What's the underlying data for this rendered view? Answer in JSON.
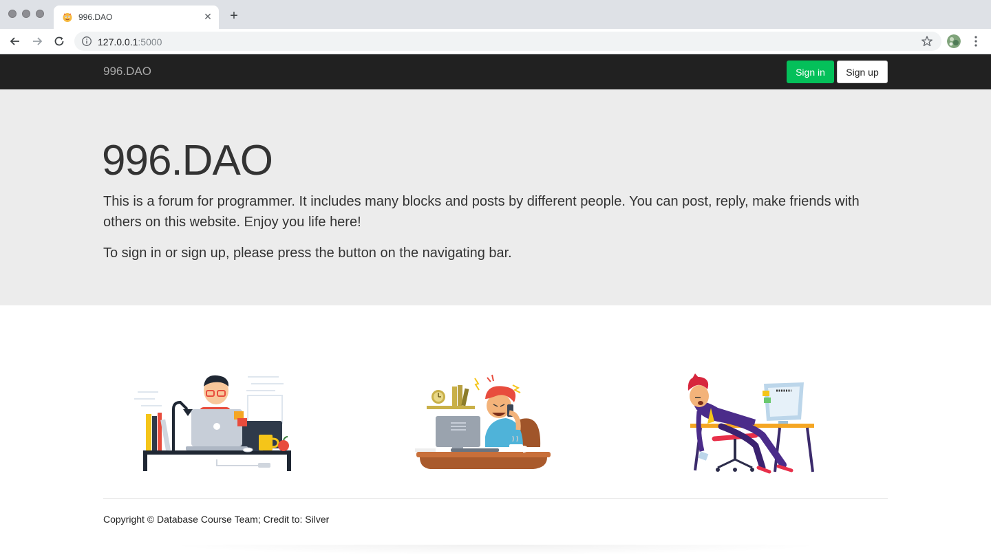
{
  "browser": {
    "tab_title": "996.DAO",
    "tab_favicon": "emoji-face-icon",
    "url_host": "127.0.0.1",
    "url_port": ":5000"
  },
  "navbar": {
    "brand": "996.DAO",
    "signin_label": "Sign in",
    "signup_label": "Sign up",
    "colors": {
      "background": "#212121",
      "signin": "#04c05a"
    }
  },
  "jumbotron": {
    "title": "996.DAO",
    "lead": "This is a forum for programmer. It includes many blocks and posts by different people. You can post, reply, make friends with others on this website. Enjoy you life here!",
    "sub": "To sign in or sign up, please press the button on the navigating bar."
  },
  "illustrations": [
    {
      "icon": "programmer-at-laptop-illustration"
    },
    {
      "icon": "stressed-programmer-on-phone-illustration"
    },
    {
      "icon": "tired-programmer-sleeping-illustration"
    }
  ],
  "footer": {
    "copyright": "Copyright © Database Course Team; Credit to: Silver"
  }
}
